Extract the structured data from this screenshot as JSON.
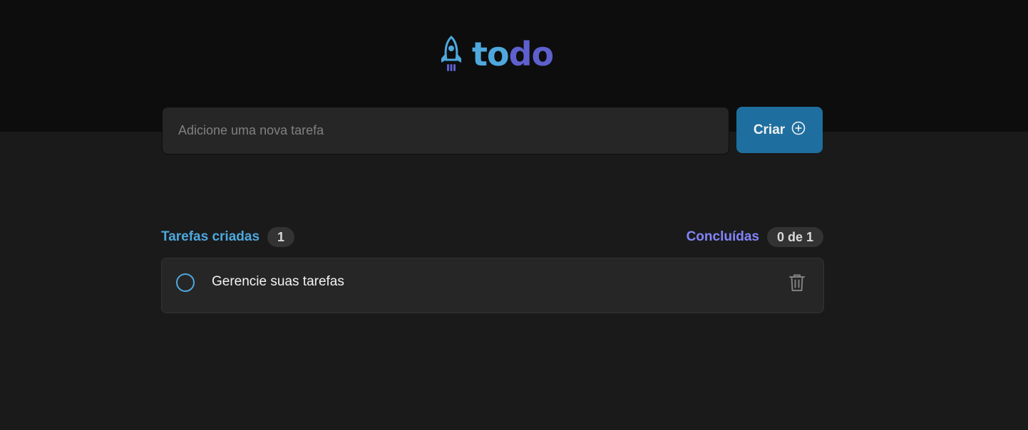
{
  "header": {
    "logo": {
      "icon": "rocket-icon",
      "text_part1": "to",
      "text_part2": "do"
    }
  },
  "new_task": {
    "placeholder": "Adicione uma nova tarefa",
    "value": "",
    "create_label": "Criar",
    "create_icon": "plus-circle-icon"
  },
  "counters": {
    "created_label": "Tarefas criadas",
    "created_count": "1",
    "done_label": "Concluídas",
    "done_count": "0 de 1"
  },
  "tasks": [
    {
      "text": "Gerencie suas tarefas",
      "completed": false,
      "delete_icon": "trash-icon"
    }
  ],
  "colors": {
    "blue": "#4ea8de",
    "purple": "#5e60ce",
    "purple_light": "#8284fa",
    "button": "#1e6f9f",
    "header_bg": "#0d0d0d",
    "body_bg": "#1a1a1a"
  }
}
